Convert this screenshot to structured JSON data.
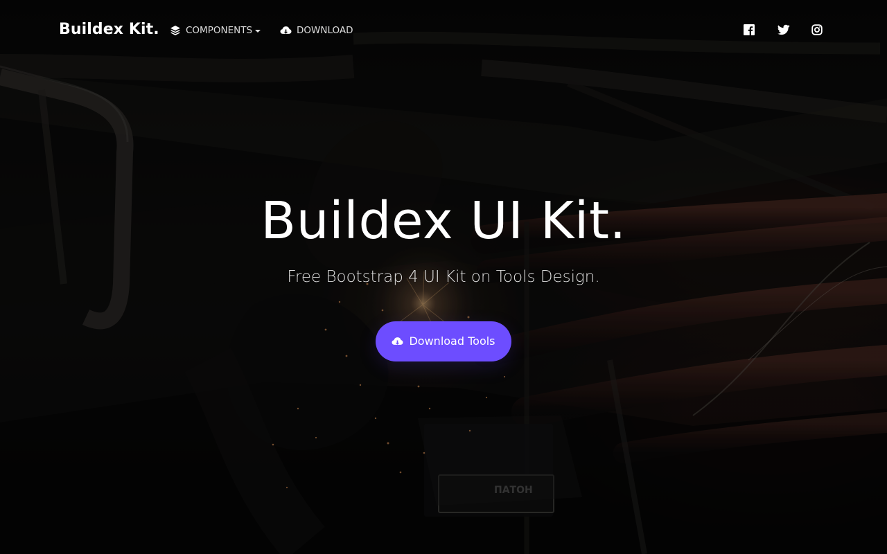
{
  "brand": {
    "name": "Buildex Kit."
  },
  "nav": {
    "components": {
      "label": "COMPONENTS",
      "icon": "layers-icon"
    },
    "download": {
      "label": "DOWNLOAD",
      "icon": "cloud-download-icon"
    }
  },
  "social": {
    "facebook": "facebook-icon",
    "twitter": "twitter-icon",
    "instagram": "instagram-icon"
  },
  "hero": {
    "title": "Buildex UI Kit.",
    "subtitle": "Free Bootstrap 4 UI Kit on Tools Design.",
    "cta_label": "Download Tools",
    "cta_icon": "cloud-download-icon",
    "background_image": "welding workshop background",
    "device_label": "ПАТОН"
  },
  "colors": {
    "cta": "#6d4dff",
    "text": "#ffffff",
    "background": "#0b0b0c"
  }
}
